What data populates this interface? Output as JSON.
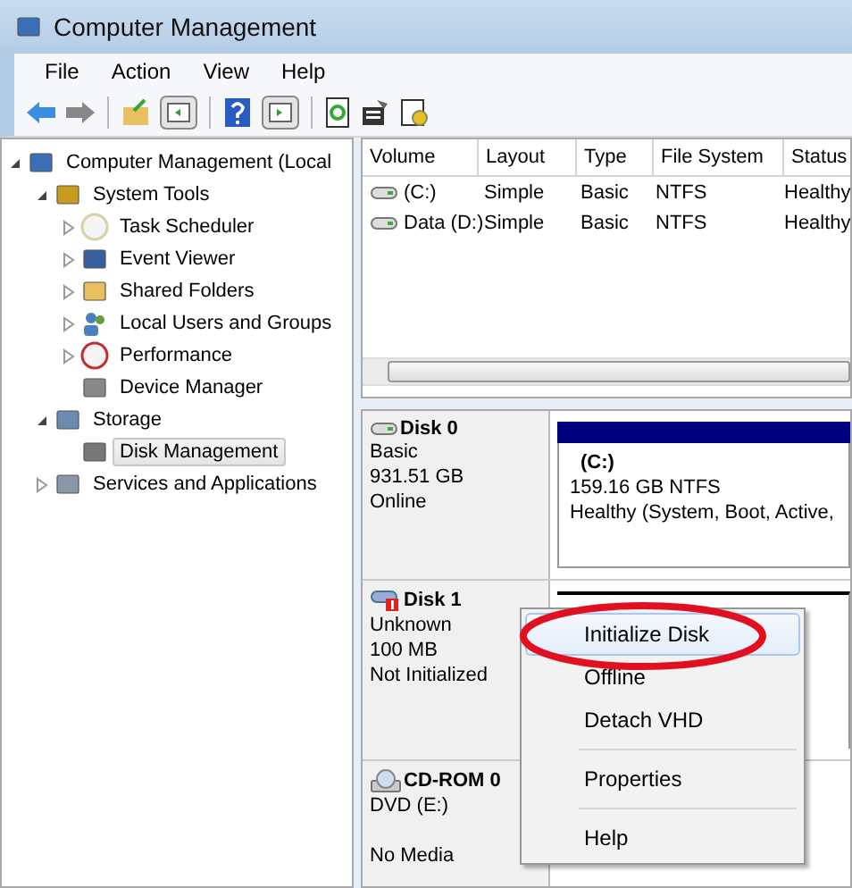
{
  "window": {
    "title": "Computer Management"
  },
  "menu_bar": [
    "File",
    "Action",
    "View",
    "Help"
  ],
  "tree": [
    {
      "label": "Computer Management (Local",
      "expanded": true,
      "selected": false,
      "children": [
        {
          "label": "System Tools",
          "expanded": true,
          "selected": false,
          "children": [
            {
              "label": "Task Scheduler",
              "expanded": false,
              "selected": false
            },
            {
              "label": "Event Viewer",
              "expanded": false,
              "selected": false
            },
            {
              "label": "Shared Folders",
              "expanded": false,
              "selected": false
            },
            {
              "label": "Local Users and Groups",
              "expanded": false,
              "selected": false
            },
            {
              "label": "Performance",
              "expanded": false,
              "selected": false
            },
            {
              "label": "Device Manager",
              "selected": false
            }
          ]
        },
        {
          "label": "Storage",
          "expanded": true,
          "selected": false,
          "children": [
            {
              "label": "Disk Management",
              "selected": true
            }
          ]
        },
        {
          "label": "Services and Applications",
          "expanded": false,
          "selected": false
        }
      ]
    }
  ],
  "volume_table": {
    "columns": [
      "Volume",
      "Layout",
      "Type",
      "File System",
      "Status"
    ],
    "rows": [
      [
        "(C:)",
        "Simple",
        "Basic",
        "NTFS",
        "Healthy"
      ],
      [
        "Data (D:)",
        "Simple",
        "Basic",
        "NTFS",
        "Healthy"
      ]
    ]
  },
  "disks": [
    {
      "kind": "disk",
      "name": "Disk 0",
      "lines": [
        "Basic",
        "931.51 GB",
        "Online"
      ],
      "partition": {
        "label": "(C:)",
        "size": "159.16 GB NTFS",
        "status": "Healthy (System, Boot, Active,"
      }
    },
    {
      "kind": "unknown",
      "name": "Disk 1",
      "lines": [
        "Unknown",
        "100 MB",
        "Not Initialized"
      ]
    },
    {
      "kind": "cdrom",
      "name": "CD-ROM 0",
      "lines": [
        "DVD (E:)",
        "No Media"
      ]
    }
  ],
  "context_menu": [
    {
      "kind": "item",
      "label": "Initialize Disk",
      "selected": true
    },
    {
      "kind": "item",
      "label": "Offline",
      "selected": false
    },
    {
      "kind": "item",
      "label": "Detach VHD",
      "selected": false
    },
    {
      "kind": "separator"
    },
    {
      "kind": "item",
      "label": "Properties",
      "selected": false
    },
    {
      "kind": "separator"
    },
    {
      "kind": "item",
      "label": "Help",
      "selected": false
    }
  ]
}
